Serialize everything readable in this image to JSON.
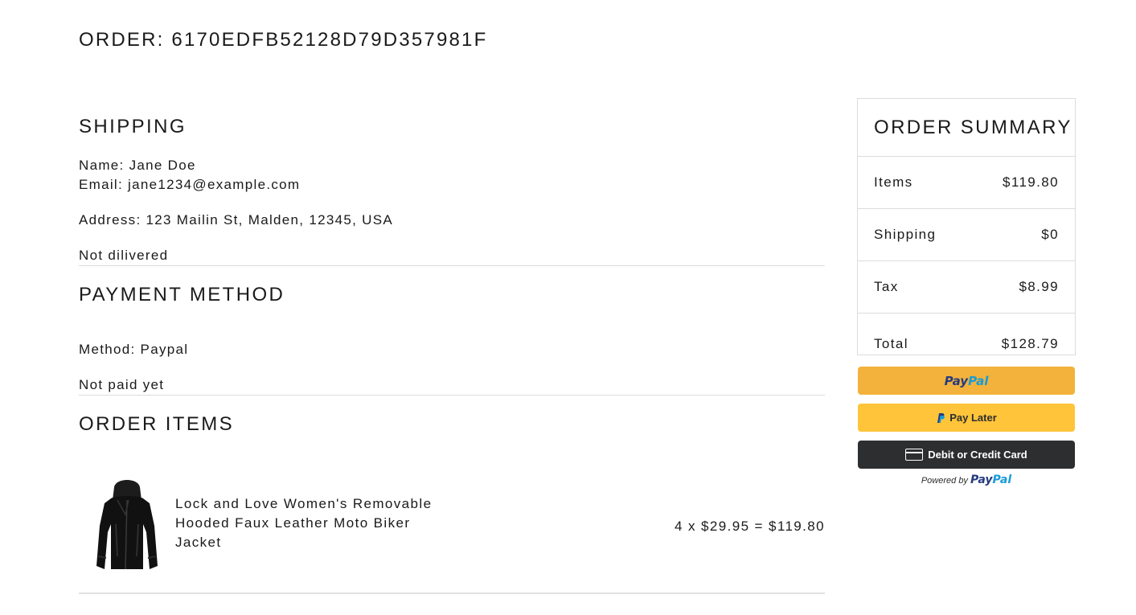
{
  "order": {
    "title": "ORDER: 6170EDFB52128D79D357981F"
  },
  "shipping": {
    "heading": "SHIPPING",
    "name_line": "Name: Jane Doe",
    "email_line": "Email: jane1234@example.com",
    "address_line": "Address: 123 Mailin St, Malden, 12345, USA",
    "status": "Not dilivered"
  },
  "payment": {
    "heading": "PAYMENT METHOD",
    "method_line": "Method: Paypal",
    "status": "Not paid yet"
  },
  "order_items": {
    "heading": "ORDER ITEMS",
    "items": [
      {
        "name": "Lock and Love Women's Removable Hooded Faux Leather Moto Biker Jacket",
        "line_total": "4 x $29.95 = $119.80",
        "image": "black-leather-jacket"
      }
    ]
  },
  "summary": {
    "heading": "ORDER SUMMARY",
    "rows": [
      {
        "label": "Items",
        "value": "$119.80"
      },
      {
        "label": "Shipping",
        "value": "$0"
      },
      {
        "label": "Tax",
        "value": "$8.99"
      },
      {
        "label": "Total",
        "value": "$128.79"
      }
    ]
  },
  "paypal": {
    "logo_part1": "Pay",
    "logo_part2": "Pal",
    "pay_later_label": "Pay Later",
    "card_label": "Debit or Credit Card",
    "powered_by": "Powered by",
    "colors": {
      "paypal_button": "#f2b23b",
      "pay_later_button": "#ffc439",
      "card_button": "#2c2e2f",
      "logo_dark": "#253b80",
      "logo_light": "#179bd7"
    }
  }
}
